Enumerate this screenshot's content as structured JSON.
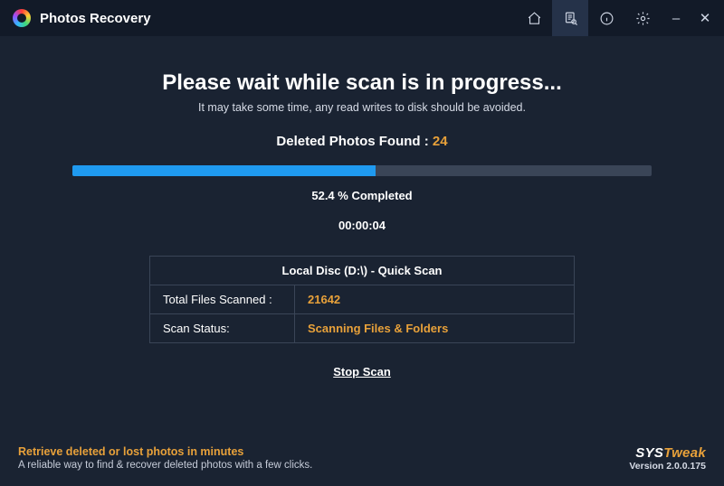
{
  "app": {
    "title": "Photos Recovery"
  },
  "nav": {
    "icons": {
      "home": "home-icon",
      "scan": "scan-icon",
      "info": "info-icon",
      "settings": "gear-icon"
    }
  },
  "window": {
    "minimize": "–",
    "close": "✕"
  },
  "scan": {
    "headline": "Please wait while scan is in progress...",
    "subline": "It may take some time, any read writes to disk should be avoided.",
    "found_label": "Deleted Photos Found : ",
    "found_count": "24",
    "progress_percent": 52.4,
    "percent_text": "52.4 % Completed",
    "elapsed": "00:00:04",
    "details_header": "Local Disc (D:\\) - Quick Scan",
    "rows": {
      "files_label": "Total Files Scanned :",
      "files_value": "21642",
      "status_label": "Scan Status:",
      "status_value": "Scanning Files & Folders"
    },
    "stop_label": "Stop Scan"
  },
  "footer": {
    "tagline": "Retrieve deleted or lost photos in minutes",
    "tagdesc": "A reliable way to find & recover deleted photos with a few clicks.",
    "brand_part1": "SYS",
    "brand_part2": "Tweak",
    "version": "Version 2.0.0.175"
  }
}
